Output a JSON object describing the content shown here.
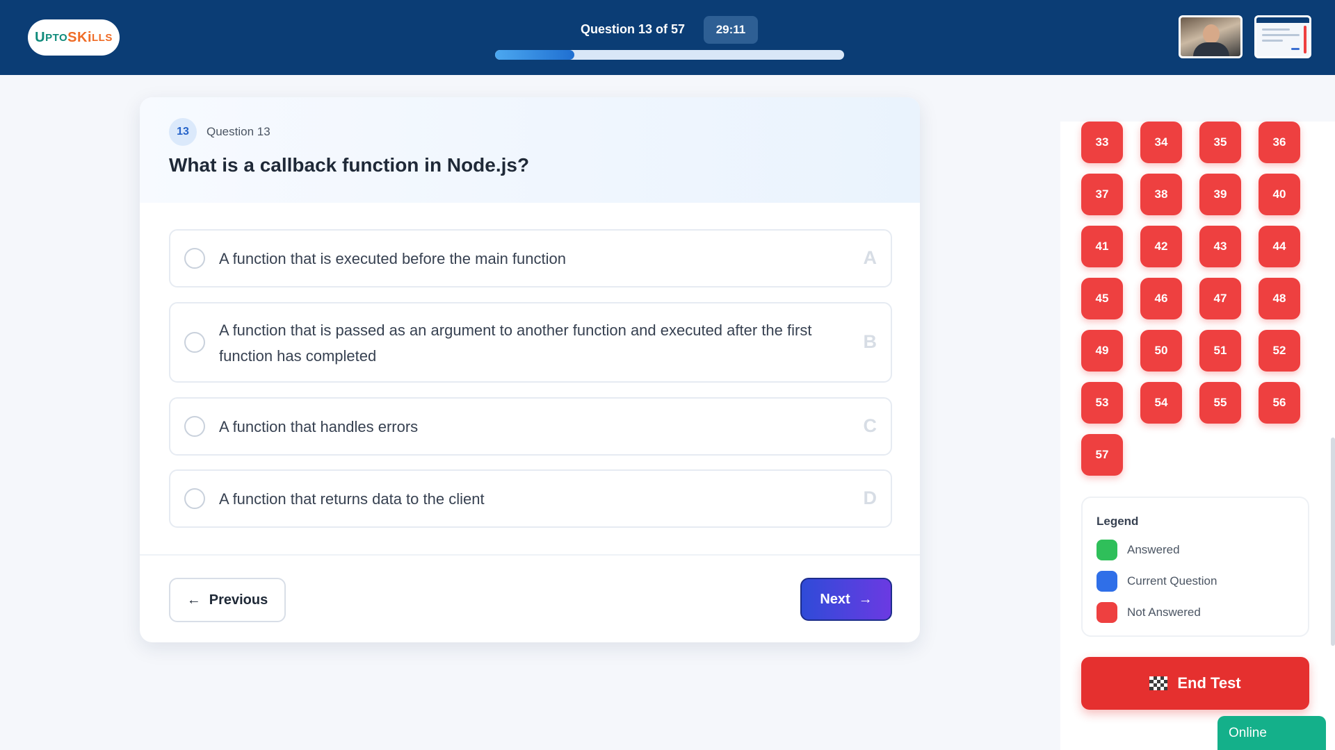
{
  "header": {
    "logo": "UptoSkills",
    "question_counter": "Question 13 of 57",
    "timer": "29:11",
    "progress_fraction": 0.228
  },
  "question": {
    "number": "13",
    "label": "Question 13",
    "title": "What is a callback function in Node.js?",
    "options": [
      {
        "letter": "A",
        "text": "A function that is executed before the main function"
      },
      {
        "letter": "B",
        "text": "A function that is passed as an argument to another function and executed after the first function has completed"
      },
      {
        "letter": "C",
        "text": "A function that handles errors"
      },
      {
        "letter": "D",
        "text": "A function that returns data to the client"
      }
    ]
  },
  "navigation": {
    "previous": "Previous",
    "previous_icon": "←",
    "next": "Next",
    "next_icon": "→"
  },
  "palette": {
    "visible_numbers": [
      "33",
      "34",
      "35",
      "36",
      "37",
      "38",
      "39",
      "40",
      "41",
      "42",
      "43",
      "44",
      "45",
      "46",
      "47",
      "48",
      "49",
      "50",
      "51",
      "52",
      "53",
      "54",
      "55",
      "56",
      "57"
    ],
    "status": "not-answered"
  },
  "legend": {
    "title": "Legend",
    "items": [
      {
        "label": "Answered",
        "color": "#2fbf5a"
      },
      {
        "label": "Current Question",
        "color": "#2f6fe8"
      },
      {
        "label": "Not Answered",
        "color": "#ee4040"
      }
    ]
  },
  "end_test": "End Test",
  "status_badge": "Online"
}
